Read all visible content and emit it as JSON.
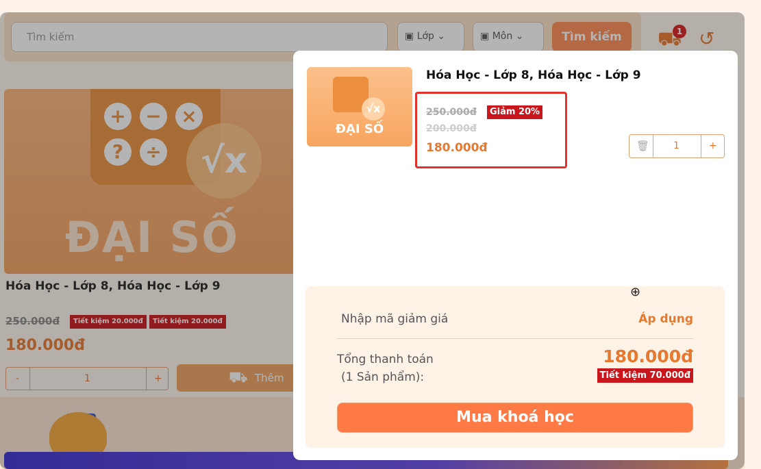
{
  "search": {
    "placeholder": "Tìm kiếm",
    "grade_filter": "Lớp",
    "subject_filter": "Môn",
    "button": "Tìm kiếm"
  },
  "header": {
    "cart_count": "1"
  },
  "product": {
    "image_title": "ĐẠI SỐ",
    "title": "Hóa Học - Lớp 8, Hóa Học - Lớp 9",
    "old_price": "250.000đ",
    "save_tag_1": "Tiết kiệm 20.000đ",
    "save_tag_2": "Tiết kiệm 20.000đ",
    "price": "180.000đ",
    "qty_minus": "-",
    "qty": "1",
    "qty_plus": "+",
    "add_to_cart": "Thêm vào"
  },
  "cart_modal": {
    "item": {
      "thumb_title": "ĐẠI SỐ",
      "title": "Hóa Học - Lớp 8, Hóa Học - Lớp 9",
      "original_price": "250.000đ",
      "discount": "Giảm 20%",
      "intermediate_price": "200.000đ",
      "final_price": "180.000đ",
      "quantity": "1",
      "plus": "+"
    },
    "summary": {
      "coupon_placeholder": "Nhập mã giảm giá",
      "apply": "Áp dụng",
      "total_label_line1": "Tổng thanh toán",
      "total_label_line2": "(1 Sản phẩm):",
      "total_value": "180.000đ",
      "savings": "Tiết kiệm 70.000đ",
      "buy_button": "Mua khoá học"
    }
  },
  "colors": {
    "accent": "#e6792f",
    "button": "#ff7a45",
    "tag_red": "#c9161c",
    "highlight_border": "#e3322e"
  },
  "icons": [
    "calendar-icon",
    "chevron-down-icon",
    "cart-icon",
    "history-icon",
    "trash-icon",
    "zoom-in-cursor-icon"
  ]
}
